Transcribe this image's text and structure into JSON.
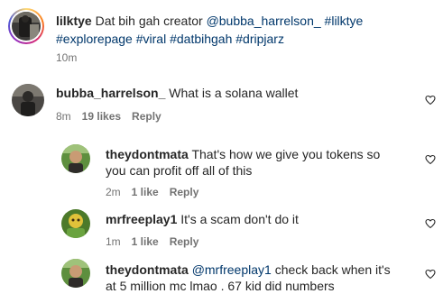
{
  "caption": {
    "username": "lilktye",
    "text": "Dat bih gah creator",
    "mention": "@bubba_harrelson_",
    "tags_line1": "#lilktye",
    "tags_line2": "#explorepage #viral #datbihgah #dripjarz",
    "time": "10m"
  },
  "comments": [
    {
      "username": "bubba_harrelson_",
      "text": "What is a solana wallet",
      "time": "8m",
      "likes": "19 likes",
      "reply": "Reply"
    },
    {
      "username": "theydontmata",
      "text_line1": "That's how we give you tokens so",
      "text_line2": "you can profit off all of this",
      "time": "2m",
      "likes": "1 like",
      "reply": "Reply"
    },
    {
      "username": "mrfreeplay1",
      "text": "It's a scam don't do it",
      "time": "1m",
      "likes": "1 like",
      "reply": "Reply"
    },
    {
      "username": "theydontmata",
      "mention": "@mrfreeplay1",
      "text_line1": "check back when it's",
      "text_line2": "at 5 million mc lmao . 67 kid did numbers"
    }
  ],
  "icons": {
    "like": "heart-outline-icon",
    "avatar": "profile-avatar-icon"
  },
  "colors": {
    "text": "#262626",
    "link": "#00376b",
    "muted": "#737373",
    "story_ring": [
      "#feda75",
      "#fa7e1e",
      "#d62976",
      "#962fbf",
      "#4f5bd5"
    ]
  }
}
